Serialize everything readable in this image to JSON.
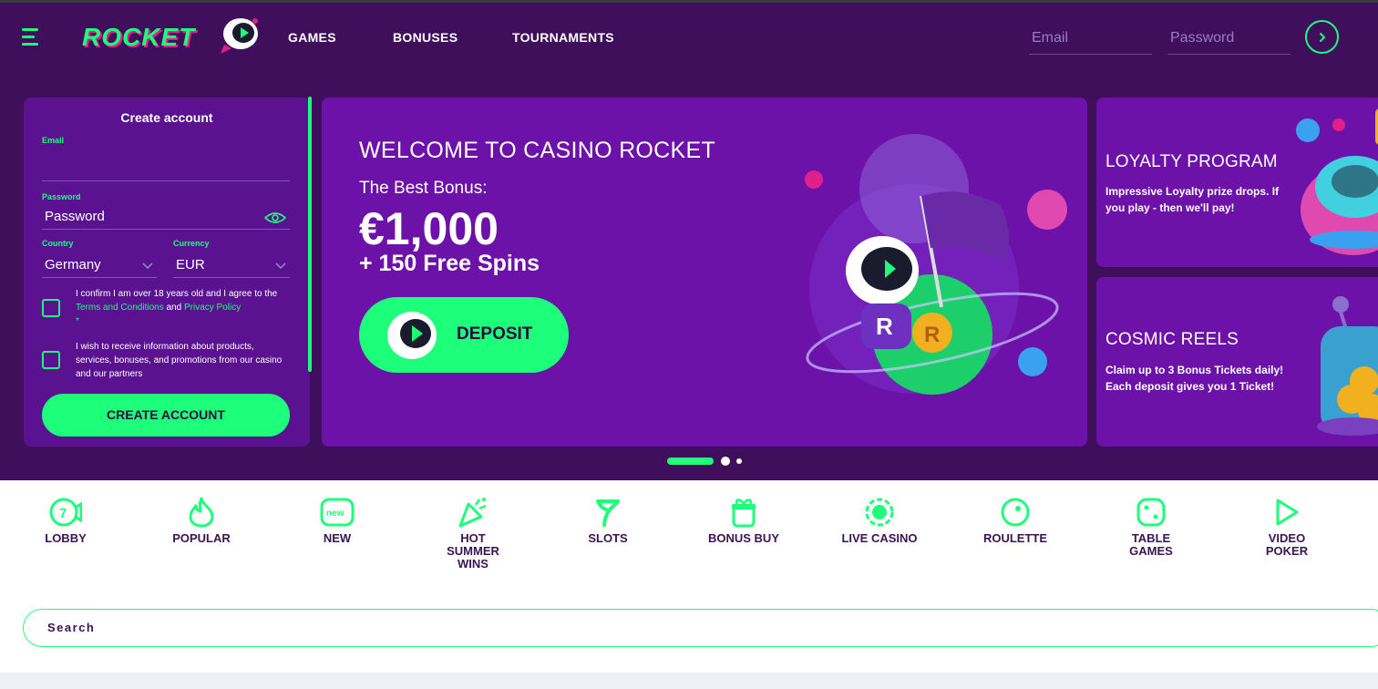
{
  "header": {
    "logo_text": "ROCKET",
    "nav": [
      "GAMES",
      "BONUSES",
      "TOURNAMENTS"
    ],
    "email_placeholder": "Email",
    "password_placeholder": "Password"
  },
  "signup": {
    "title": "Create account",
    "email_label": "Email",
    "email_value": "",
    "password_label": "Password",
    "password_value": "Password",
    "country_label": "Country",
    "country_value": "Germany",
    "currency_label": "Currency",
    "currency_value": "EUR",
    "age_text_1": "I confirm I am over 18 years old and I agree to the ",
    "terms_link": "Terms and Conditions",
    "and_text": " and ",
    "privacy_link": "Privacy Policy",
    "required_mark": "*",
    "marketing_text": "I wish to receive information about products, services, bonuses, and promotions from our casino and our partners",
    "button": "CREATE ACCOUNT"
  },
  "banner": {
    "title": "WELCOME TO CASINO ROCKET",
    "subtitle": "The Best Bonus:",
    "amount": "€1,000",
    "spins": "+ 150 Free Spins",
    "button": "DEPOSIT"
  },
  "promos": [
    {
      "title": "LOYALTY PROGRAM",
      "text": "Impressive Loyalty prize drops. If you play - then we'll pay!"
    },
    {
      "title": "COSMIC REELS",
      "text": "Claim up to 3 Bonus Tickets daily! Each deposit gives you 1 Ticket!"
    }
  ],
  "carousel": {
    "count": 3,
    "active": 0
  },
  "categories": [
    {
      "label": "LOBBY",
      "icon": "lobby-icon"
    },
    {
      "label": "POPULAR",
      "icon": "flame-icon"
    },
    {
      "label": "NEW",
      "icon": "new-icon"
    },
    {
      "label": "HOT SUMMER WINS",
      "icon": "party-popper-icon"
    },
    {
      "label": "SLOTS",
      "icon": "seven-icon"
    },
    {
      "label": "BONUS BUY",
      "icon": "gift-icon"
    },
    {
      "label": "LIVE CASINO",
      "icon": "chip-icon"
    },
    {
      "label": "ROULETTE",
      "icon": "roulette-icon"
    },
    {
      "label": "TABLE GAMES",
      "icon": "dice-icon"
    },
    {
      "label": "VIDEO POKER",
      "icon": "play-icon"
    }
  ],
  "search": {
    "placeholder": "Search"
  },
  "colors": {
    "accent": "#1dff7a",
    "header_bg": "#3f0f5c",
    "panel_bg": "#5a1290",
    "banner_bg": "#6d12a8",
    "text_dark": "#3a1454"
  }
}
